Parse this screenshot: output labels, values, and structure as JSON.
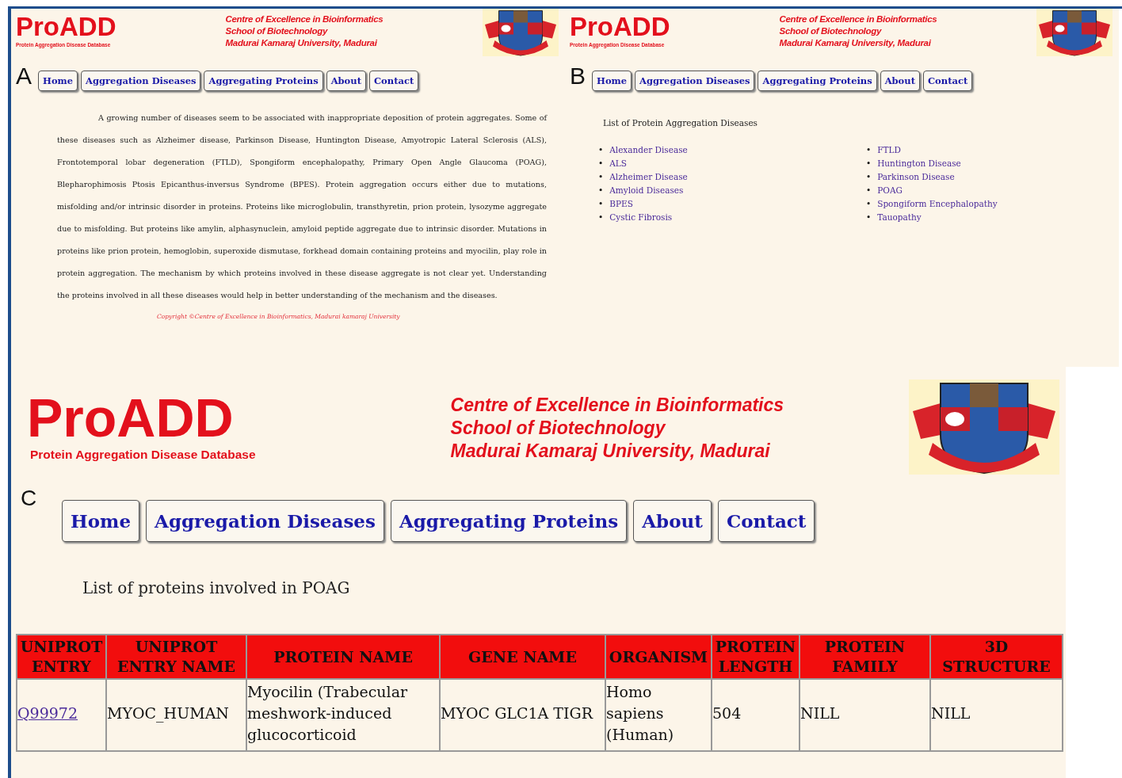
{
  "panels": [
    {
      "label": "A",
      "kind": "intro",
      "header": {
        "logo": "ProADD",
        "tagline": "Protein Aggregation Disease Database",
        "institution": [
          "Centre of Excellence in Bioinformatics",
          "School of Biotechnology",
          "Madurai Kamaraj University, Madurai"
        ]
      },
      "nav": [
        "Home",
        "Aggregation Diseases",
        "Aggregating Proteins",
        "About",
        "Contact"
      ],
      "paragraph": "A growing number of diseases seem to be associated with inappropriate deposition of protein aggregates. Some of these diseases such as Alzheimer disease, Parkinson Disease, Huntington Disease, Amyotropic Lateral Sclerosis (ALS), Frontotemporal lobar degeneration (FTLD), Spongiform encephalopathy, Primary Open Angle Glaucoma (POAG), Blepharophimosis Ptosis Epicanthus-inversus Syndrome (BPES). Protein aggregation occurs either due to mutations, misfolding and/or intrinsic disorder in proteins. Proteins like microglobulin, transthyretin, prion protein, lysozyme aggregate due to misfolding. But proteins like amylin, alphasynuclein, amyloid peptide aggregate due to intrinsic disorder. Mutations in proteins like prion protein, hemoglobin, superoxide dismutase, forkhead domain containing proteins and myocilin, play role in protein aggregation. The mechanism by which proteins involved in these disease aggregate is not clear yet. Understanding the proteins involved in all these diseases would help in better understanding of the mechanism and the diseases.",
      "copyright": "Copyright ©Centre of Excellence in Bioinformatics, Madurai kamaraj University"
    },
    {
      "label": "B",
      "kind": "disease_list",
      "header": {
        "logo": "ProADD",
        "tagline": "Protein Aggregation Disease Database",
        "institution": [
          "Centre of Excellence in Bioinformatics",
          "School of Biotechnology",
          "Madurai Kamaraj University, Madurai"
        ]
      },
      "nav": [
        "Home",
        "Aggregation Diseases",
        "Aggregating Proteins",
        "About",
        "Contact"
      ],
      "heading": "List of Protein Aggregation Diseases",
      "columns": [
        [
          {
            "bullet": "•",
            "name": "Alexander Disease"
          },
          {
            "bullet": "•",
            "name": "ALS"
          },
          {
            "bullet": "•",
            "name": "Alzheimer Disease"
          },
          {
            "bullet": "•",
            "name": "Amyloid Diseases"
          },
          {
            "bullet": "•",
            "name": "BPES"
          },
          {
            "bullet": "•",
            "name": "Cystic Fibrosis"
          }
        ],
        [
          {
            "bullet": "•",
            "name": "FTLD"
          },
          {
            "bullet": "•",
            "name": "Huntington Disease"
          },
          {
            "bullet": "•",
            "name": "Parkinson Disease"
          },
          {
            "bullet": "•",
            "name": "POAG"
          },
          {
            "bullet": "•",
            "name": "Spongiform Encephalopathy"
          },
          {
            "bullet": "•",
            "name": "Tauopathy"
          }
        ]
      ]
    },
    {
      "label": "C",
      "kind": "protein_table",
      "header": {
        "logo": "ProADD",
        "tagline": "Protein Aggregation Disease Database",
        "institution": [
          "Centre of Excellence in Bioinformatics",
          "School of Biotechnology",
          "Madurai Kamaraj University, Madurai"
        ]
      },
      "nav": [
        "Home",
        "Aggregation Diseases",
        "Aggregating Proteins",
        "About",
        "Contact"
      ],
      "heading": "List of proteins involved in POAG",
      "table": {
        "columns": [
          "UNIPROT ENTRY",
          "UNIPROT ENTRY NAME",
          "PROTEIN NAME",
          "GENE NAME",
          "ORGANISM",
          "PROTEIN LENGTH",
          "PROTEIN FAMILY",
          "3D STRUCTURE"
        ],
        "rows": [
          [
            "Q99972",
            "MYOC_HUMAN",
            "Myocilin (Trabecular meshwork-induced glucocorticoid",
            "MYOC GLC1A TIGR",
            "Homo sapiens (Human)",
            "504",
            "NILL",
            "NILL"
          ]
        ]
      }
    }
  ]
}
